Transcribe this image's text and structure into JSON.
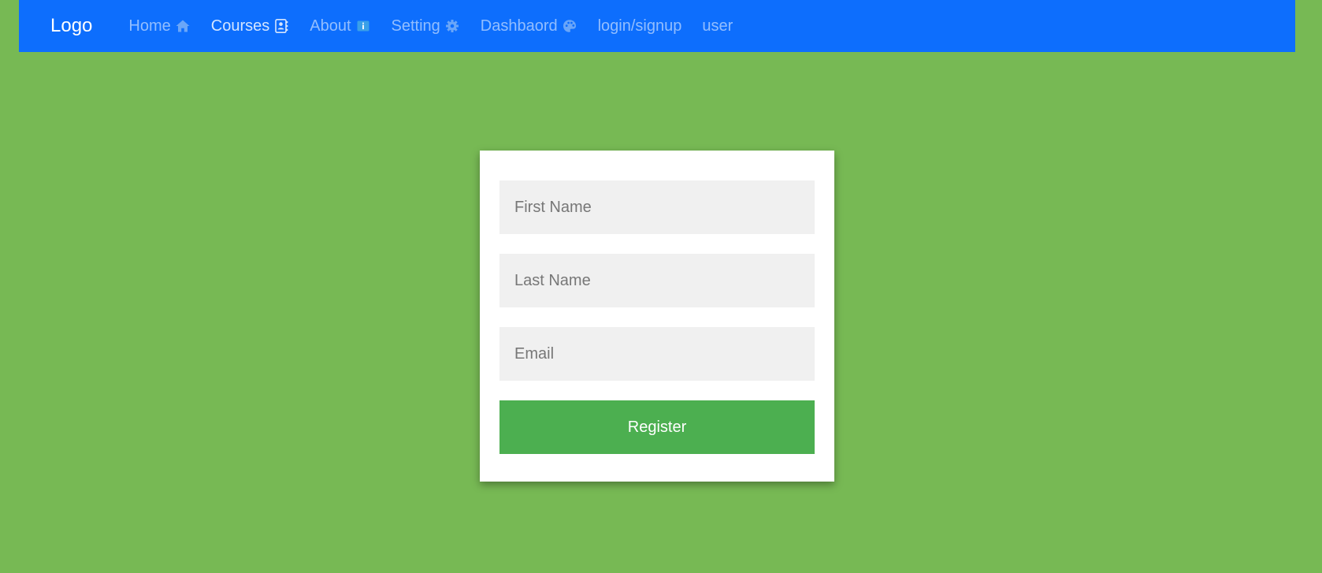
{
  "colors": {
    "page_background": "#77b954",
    "navbar_background": "#0d6efd",
    "card_background": "#ffffff",
    "input_background": "#f0f0f0",
    "button_background": "#4caf50"
  },
  "navbar": {
    "brand": "Logo",
    "items": [
      {
        "label": "Home",
        "icon": "home-icon",
        "active": false
      },
      {
        "label": "Courses",
        "icon": "address-book-icon",
        "active": true
      },
      {
        "label": "About",
        "icon": "info-icon",
        "active": false
      },
      {
        "label": "Setting",
        "icon": "gear-icon",
        "active": false
      },
      {
        "label": "Dashbaord",
        "icon": "palette-icon",
        "active": false
      },
      {
        "label": "login/signup",
        "icon": "",
        "active": false
      },
      {
        "label": "user",
        "icon": "",
        "active": false
      }
    ]
  },
  "form": {
    "first_name": {
      "placeholder": "First Name",
      "value": ""
    },
    "last_name": {
      "placeholder": "Last Name",
      "value": ""
    },
    "email": {
      "placeholder": "Email",
      "value": ""
    },
    "submit_label": "Register"
  }
}
